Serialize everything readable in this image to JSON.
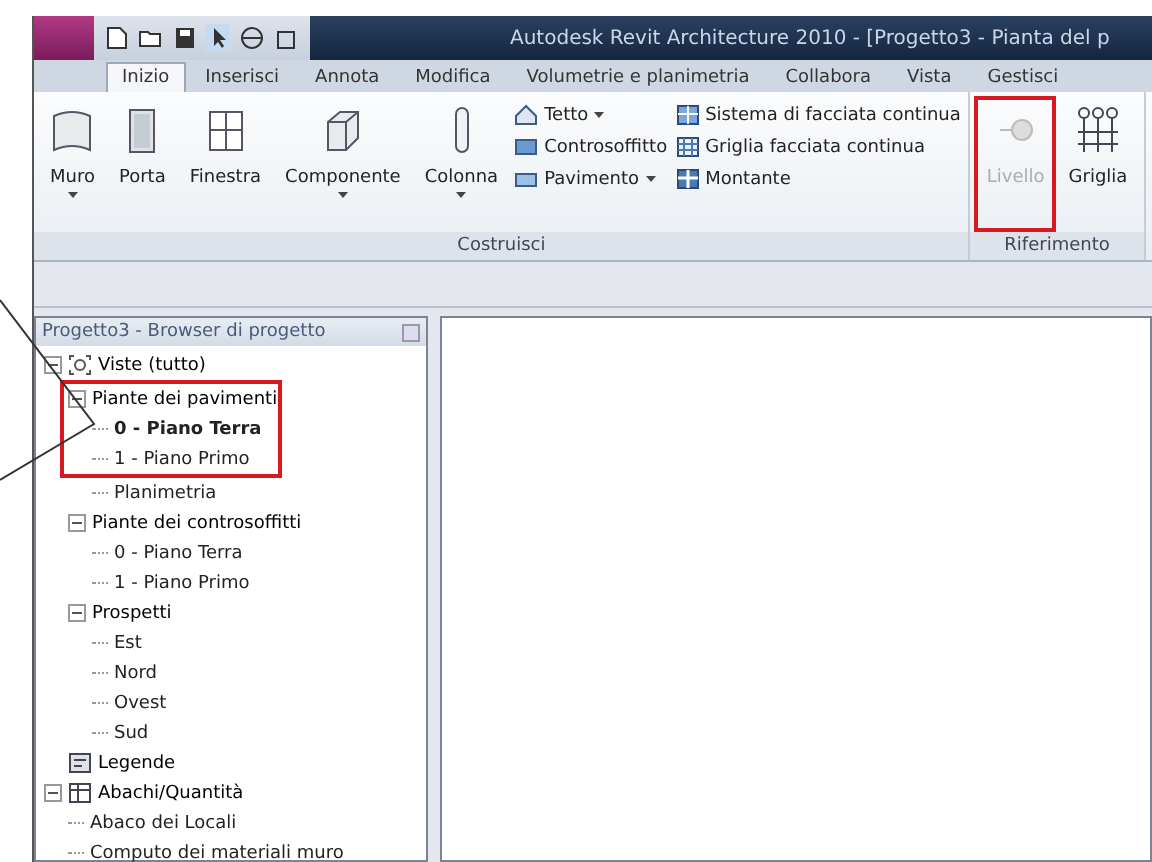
{
  "window": {
    "title": "Autodesk Revit Architecture 2010 - [Progetto3 - Pianta del p"
  },
  "tabs": [
    {
      "label": "Inizio",
      "selected": true
    },
    {
      "label": "Inserisci",
      "selected": false
    },
    {
      "label": "Annota",
      "selected": false
    },
    {
      "label": "Modifica",
      "selected": false
    },
    {
      "label": "Volumetrie e planimetria",
      "selected": false
    },
    {
      "label": "Collabora",
      "selected": false
    },
    {
      "label": "Vista",
      "selected": false
    },
    {
      "label": "Gestisci",
      "selected": false
    }
  ],
  "ribbon": {
    "groups": [
      {
        "label": "Costruisci",
        "tools": [
          {
            "kind": "large",
            "label": "Muro",
            "dropdown": true
          },
          {
            "kind": "large",
            "label": "Porta",
            "dropdown": false
          },
          {
            "kind": "large",
            "label": "Finestra",
            "dropdown": false
          },
          {
            "kind": "large",
            "label": "Componente",
            "dropdown": true
          },
          {
            "kind": "large",
            "label": "Colonna",
            "dropdown": true
          },
          {
            "kind": "stack",
            "items": [
              {
                "label": "Tetto",
                "dropdown": true
              },
              {
                "label": "Controsoffitto",
                "dropdown": false
              },
              {
                "label": "Pavimento",
                "dropdown": true
              }
            ]
          },
          {
            "kind": "stack",
            "items": [
              {
                "label": "Sistema di facciata continua",
                "dropdown": false
              },
              {
                "label": "Griglia facciata continua",
                "dropdown": false
              },
              {
                "label": "Montante",
                "dropdown": false
              }
            ]
          }
        ]
      },
      {
        "label": "Riferimento",
        "tools": [
          {
            "kind": "large",
            "label": "Livello",
            "dropdown": false,
            "disabled": true,
            "highlighted": true
          },
          {
            "kind": "large",
            "label": "Griglia",
            "dropdown": false,
            "disabled": false,
            "highlighted": false
          }
        ]
      }
    ]
  },
  "browser": {
    "title": "Progetto3 - Browser di progetto",
    "tree": [
      {
        "label": "Viste (tutto)",
        "expanded": true,
        "children": [
          {
            "label": "Piante dei pavimenti",
            "expanded": true,
            "highlighted": true,
            "children": [
              {
                "label": "0 - Piano Terra",
                "selected": true,
                "highlighted": true
              },
              {
                "label": "1 - Piano Primo",
                "selected": false,
                "highlighted": true
              },
              {
                "label": "Planimetria",
                "selected": false,
                "highlighted": false
              }
            ]
          },
          {
            "label": "Piante dei controsoffitti",
            "expanded": true,
            "children": [
              {
                "label": "0 - Piano Terra",
                "selected": false
              },
              {
                "label": "1 - Piano Primo",
                "selected": false
              }
            ]
          },
          {
            "label": "Prospetti",
            "expanded": true,
            "children": [
              {
                "label": "Est",
                "selected": false
              },
              {
                "label": "Nord",
                "selected": false
              },
              {
                "label": "Ovest",
                "selected": false
              },
              {
                "label": "Sud",
                "selected": false
              }
            ]
          }
        ]
      },
      {
        "label": "Legende"
      },
      {
        "label": "Abachi/Quantità",
        "expanded": true,
        "children": [
          {
            "label": "Abaco dei Locali",
            "selected": false
          },
          {
            "label": "Computo dei materiali muro",
            "selected": false
          }
        ]
      }
    ]
  }
}
